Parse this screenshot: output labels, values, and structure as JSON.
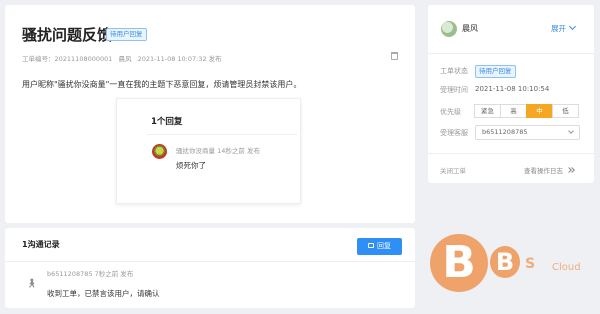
{
  "ticket": {
    "title": "骚扰问题反馈",
    "status_tag": "待用户回复",
    "number_label": "工单编号：",
    "number": "20211108000001",
    "author": "晨风",
    "created": "2021-11-08 10:07:32",
    "created_suffix": "发布",
    "body": "用户昵称\"骚扰你没商量\"一直在我的主题下恶意回复，烦请管理员封禁该用户。",
    "replies": {
      "title": "1个回复",
      "user": "骚扰你没商量",
      "time": "14秒之前",
      "time_suffix": "发布",
      "text": "烦死你了"
    }
  },
  "side": {
    "name": "晨风",
    "expand_label": "展开",
    "status_label": "工单状态",
    "status_tag": "待用户回复",
    "time_label": "受理时间",
    "time_value": "2021-11-08 10:10:54",
    "priority_label": "优先级",
    "priorities": [
      "紧急",
      "高",
      "中",
      "低"
    ],
    "priority_selected": "中",
    "assignee_label": "受理客服",
    "assignee_value": "b6511208785",
    "close_label": "关闭工单",
    "log_label": "查看操作日志"
  },
  "records": {
    "title": "1沟通记录",
    "reply_button": "回复",
    "author": "b6511208785",
    "time": "7秒之前",
    "time_suffix": "发布",
    "text": "收到工单，已禁言该用户，请确认"
  },
  "watermark": {
    "big_letter": "B",
    "letters": "BS",
    "word": "Cloud"
  },
  "colors": {
    "accent": "#2f8ff5",
    "priority_active": "#f5a623",
    "watermark": "#f0a26b"
  }
}
